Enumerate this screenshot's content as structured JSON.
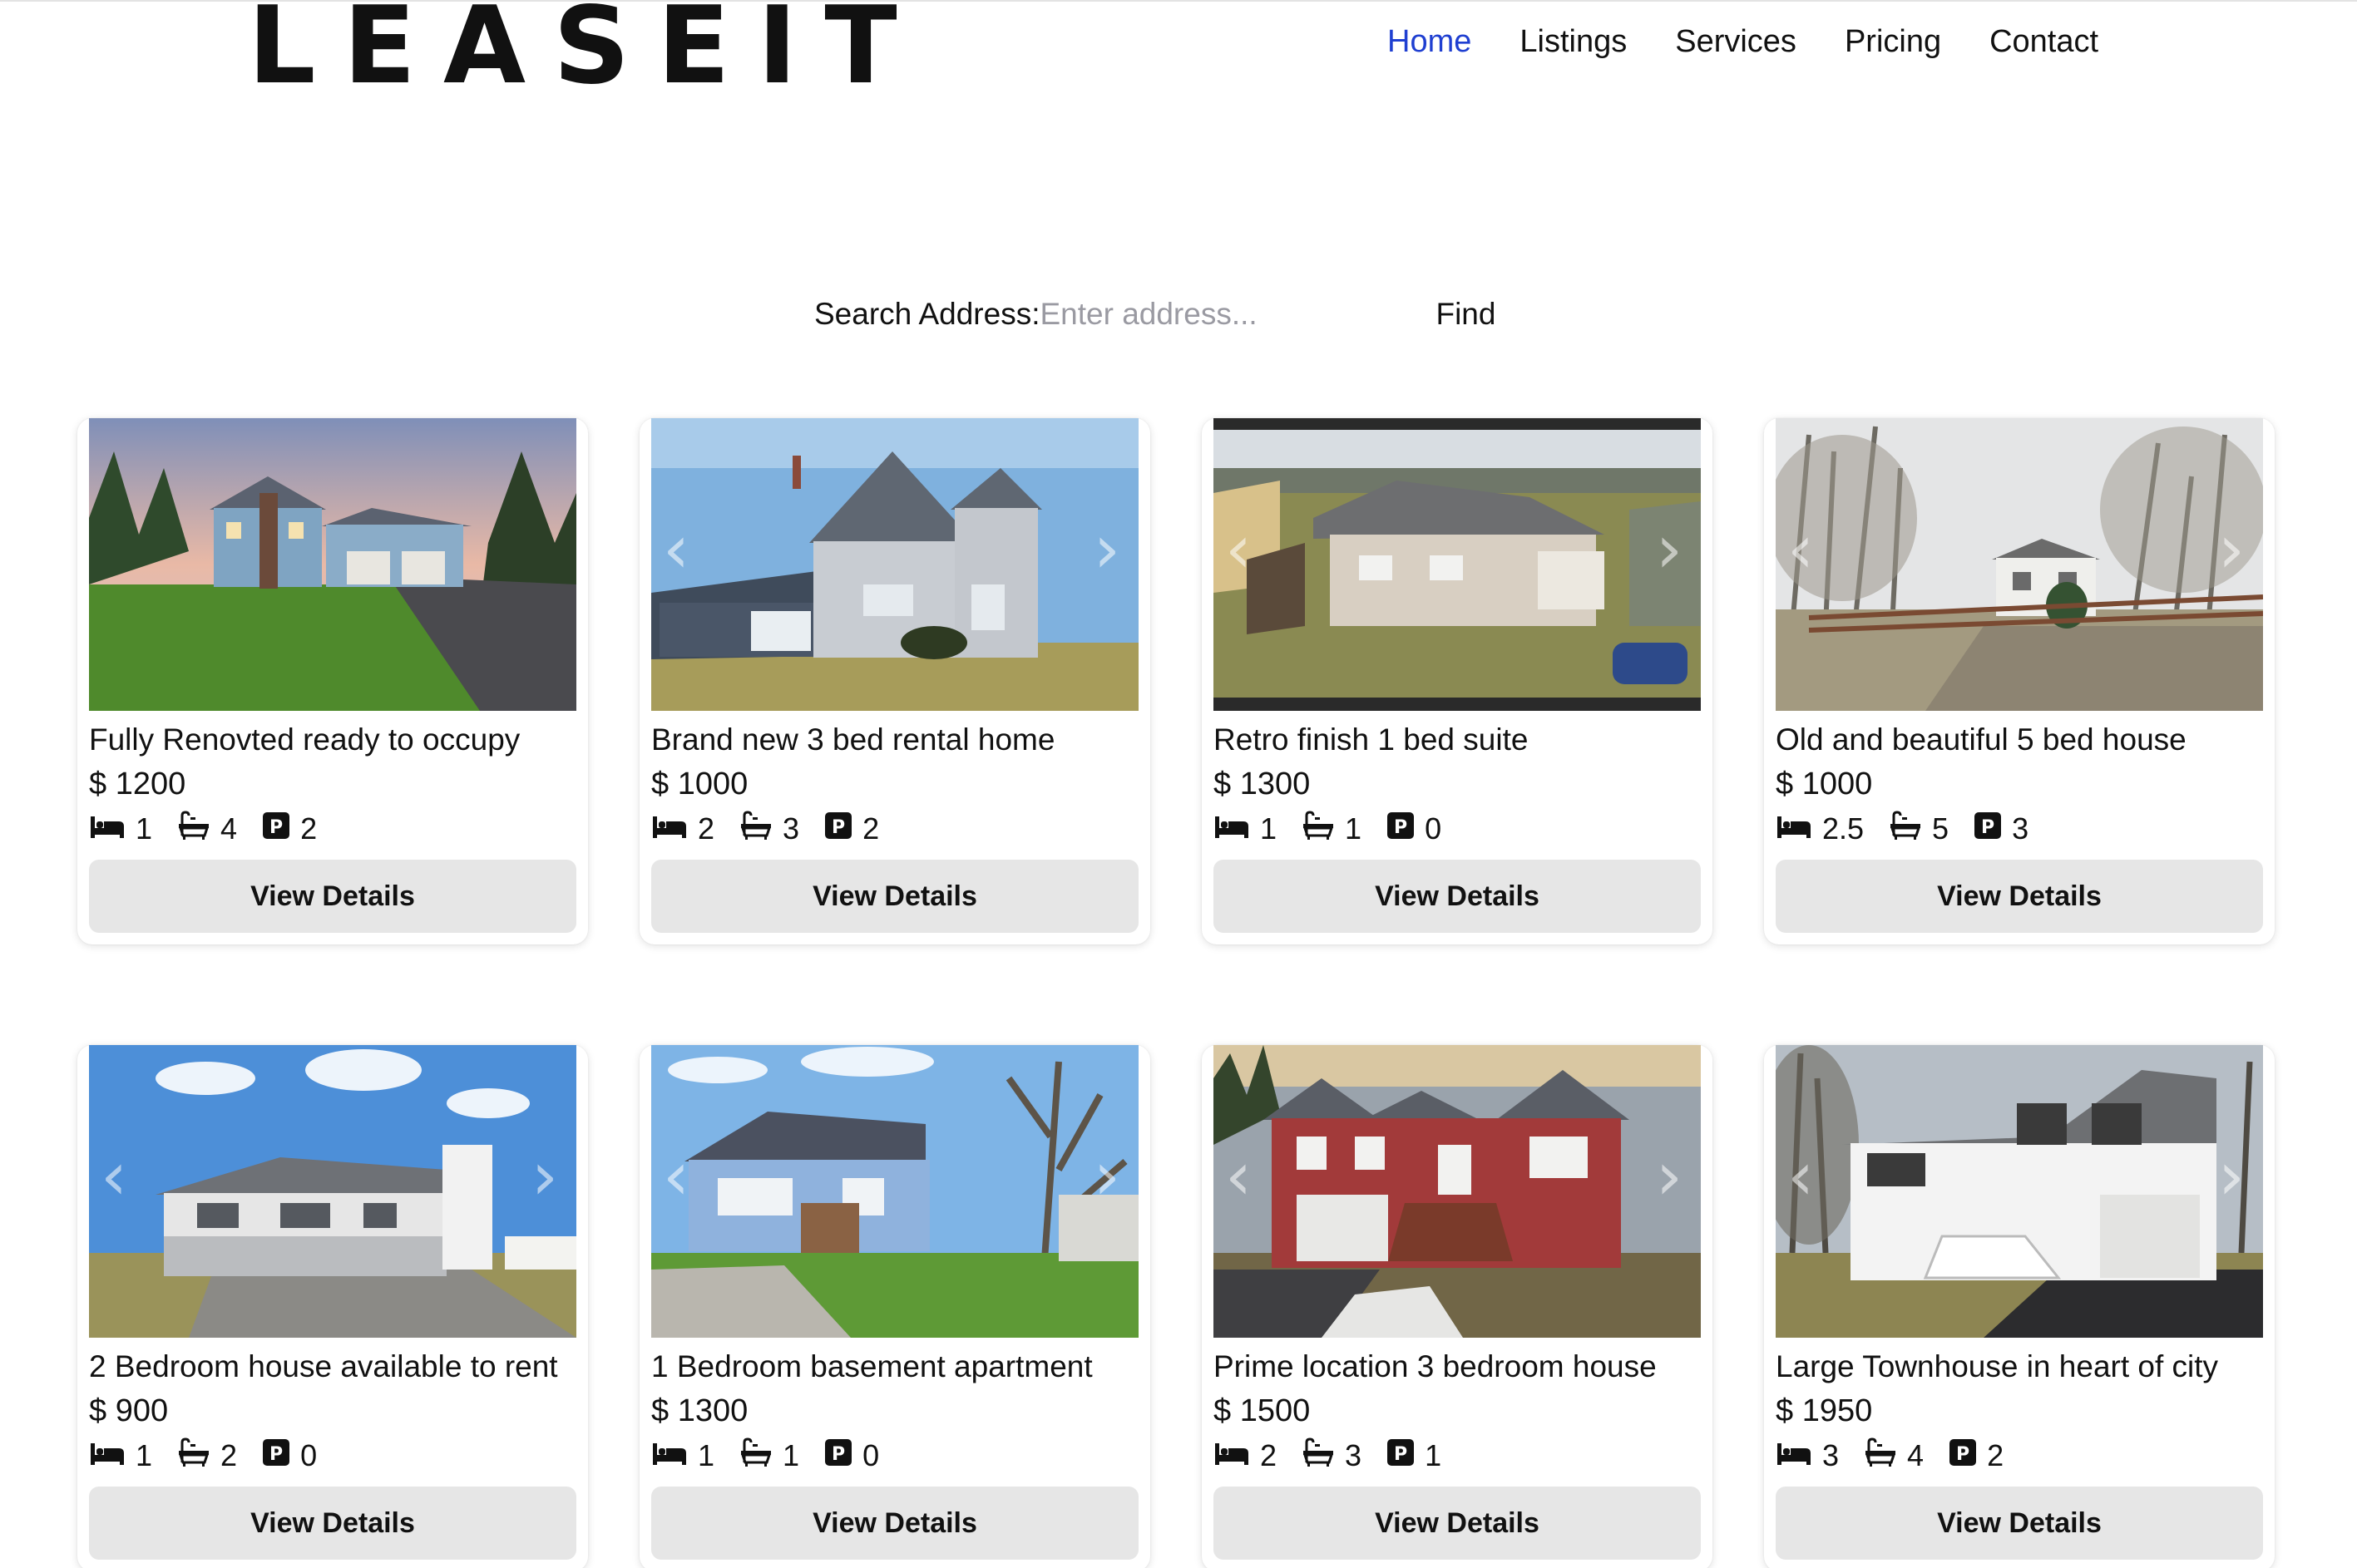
{
  "brand": {
    "logo": "LEASEIT"
  },
  "nav": [
    {
      "label": "Home",
      "active": true
    },
    {
      "label": "Listings",
      "active": false
    },
    {
      "label": "Services",
      "active": false
    },
    {
      "label": "Pricing",
      "active": false
    },
    {
      "label": "Contact",
      "active": false
    }
  ],
  "search": {
    "label": "Search Address:",
    "placeholder": "Enter address...",
    "value": "",
    "button": "Find"
  },
  "listings": [
    {
      "title": "Fully Renovted ready to occupy",
      "price": "$ 1200",
      "beds": "1",
      "baths": "4",
      "parking": "2",
      "button": "View Details"
    },
    {
      "title": "Brand new 3 bed rental home",
      "price": "$ 1000",
      "beds": "2",
      "baths": "3",
      "parking": "2",
      "button": "View Details"
    },
    {
      "title": "Retro finish 1 bed suite",
      "price": "$ 1300",
      "beds": "1",
      "baths": "1",
      "parking": "0",
      "button": "View Details"
    },
    {
      "title": "Old and beautiful 5 bed house",
      "price": "$ 1000",
      "beds": "2.5",
      "baths": "5",
      "parking": "3",
      "button": "View Details"
    },
    {
      "title": "2 Bedroom house available to rent",
      "price": "$ 900",
      "beds": "1",
      "baths": "2",
      "parking": "0",
      "button": "View Details"
    },
    {
      "title": "1 Bedroom basement apartment",
      "price": "$ 1300",
      "beds": "1",
      "baths": "1",
      "parking": "0",
      "button": "View Details"
    },
    {
      "title": "Prime location 3 bedroom house",
      "price": "$ 1500",
      "beds": "2",
      "baths": "3",
      "parking": "1",
      "button": "View Details"
    },
    {
      "title": "Large Townhouse in heart of city",
      "price": "$ 1950",
      "beds": "3",
      "baths": "4",
      "parking": "2",
      "button": "View Details"
    }
  ],
  "icons": {
    "beds": "bed-icon",
    "baths": "bathtub-icon",
    "parking": "parking-icon"
  },
  "colors": {
    "nav_active": "#1f3fd1",
    "button_bg": "#e6e6e6"
  }
}
